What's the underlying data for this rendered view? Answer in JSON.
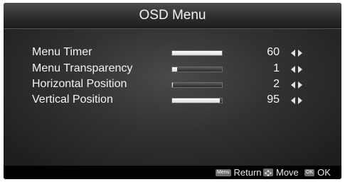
{
  "header": {
    "title": "OSD Menu"
  },
  "menu": {
    "items": [
      {
        "label": "Menu Timer",
        "value": "60",
        "level": 1.0
      },
      {
        "label": "Menu Transparency",
        "value": "1",
        "level": 0.1
      },
      {
        "label": "Horizontal Position",
        "value": "2",
        "level": 0.02
      },
      {
        "label": "Vertical Position",
        "value": "95",
        "level": 0.95
      }
    ]
  },
  "footer": {
    "return_key": "Menu",
    "return_label": "Return",
    "move_label": "Move",
    "ok_key": "OK",
    "ok_label": "OK"
  },
  "icons": {
    "adjust": "left-right-arrows-icon",
    "move": "direction-pad-icon"
  }
}
